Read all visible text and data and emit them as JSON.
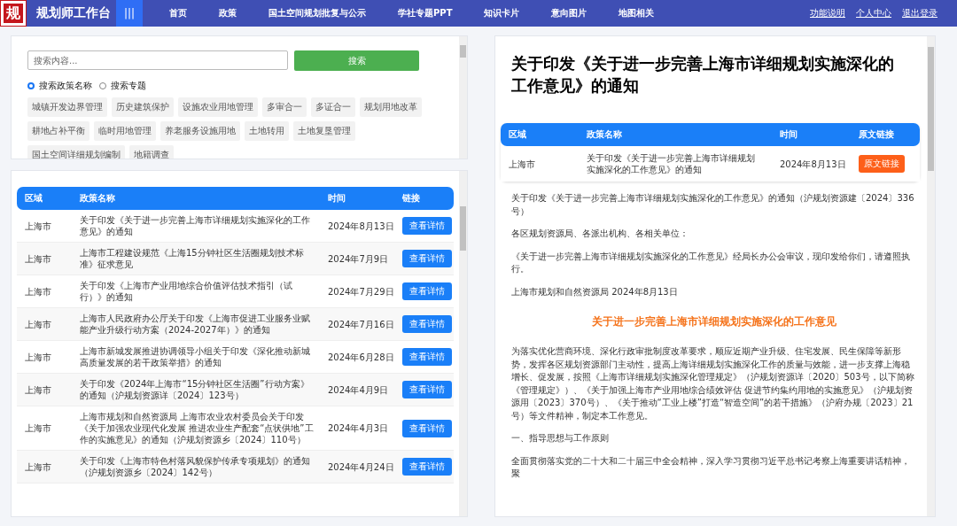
{
  "header": {
    "logo": "规",
    "title": "规划师工作台",
    "menu_button": "|||",
    "nav": [
      {
        "label": "首页"
      },
      {
        "label": "政策"
      },
      {
        "label": "国土空间规划批复与公示"
      },
      {
        "label": "学社专题PPT"
      },
      {
        "label": "知识卡片"
      },
      {
        "label": "意向图片"
      },
      {
        "label": "地图相关"
      }
    ],
    "links": [
      "功能说明",
      "个人中心",
      "退出登录"
    ]
  },
  "search": {
    "placeholder": "搜索内容...",
    "button": "搜索",
    "modes": [
      {
        "label": "搜索政策名称",
        "selected": true
      },
      {
        "label": "搜索专题",
        "selected": false
      }
    ],
    "tags": [
      "城镇开发边界管理",
      "历史建筑保护",
      "设施农业用地管理",
      "多审合一",
      "多证合一",
      "规划用地改革",
      "耕地占补平衡",
      "临时用地管理",
      "养老服务设施用地",
      "土地转用",
      "土地复垦管理",
      "国土空间详细规划编制",
      "地籍调查"
    ]
  },
  "policy_table": {
    "columns": [
      "区域",
      "政策名称",
      "时间",
      "链接"
    ],
    "rows": [
      {
        "region": "上海市",
        "name": "关于印发《关于进一步完善上海市详细规划实施深化的工作意见》的通知",
        "date": "2024年8月13日",
        "action": "查看详情"
      },
      {
        "region": "上海市",
        "name": "上海市工程建设规范《上海15分钟社区生活圈规划技术标准》征求意见",
        "date": "2024年7月9日",
        "action": "查看详情"
      },
      {
        "region": "上海市",
        "name": "关于印发《上海市产业用地综合价值评估技术指引（试行）》的通知",
        "date": "2024年7月29日",
        "action": "查看详情"
      },
      {
        "region": "上海市",
        "name": "上海市人民政府办公厅关于印发《上海市促进工业服务业赋能产业升级行动方案（2024-2027年）》的通知",
        "date": "2024年7月16日",
        "action": "查看详情"
      },
      {
        "region": "上海市",
        "name": "上海市新城发展推进协调领导小组关于印发《深化推动新城高质量发展的若干政策举措》的通知",
        "date": "2024年6月28日",
        "action": "查看详情"
      },
      {
        "region": "上海市",
        "name": "关于印发《2024年上海市“15分钟社区生活圈”行动方案》的通知（沪规划资源详〔2024〕123号）",
        "date": "2024年4月9日",
        "action": "查看详情"
      },
      {
        "region": "上海市",
        "name": "上海市规划和自然资源局 上海市农业农村委员会关于印发《关于加强农业现代化发展 推进农业生产配套“点状供地”工作的实施意见》的通知（沪规划资源乡〔2024〕110号）",
        "date": "2024年4月3日",
        "action": "查看详情"
      },
      {
        "region": "上海市",
        "name": "关于印发《上海市特色村落风貌保护传承专项规划》的通知（沪规划资源乡〔2024〕142号）",
        "date": "2024年4月24日",
        "action": "查看详情"
      }
    ]
  },
  "detail": {
    "title": "关于印发《关于进一步完善上海市详细规划实施深化的工作意见》的通知",
    "table": {
      "columns": [
        "区域",
        "政策名称",
        "时间",
        "原文链接"
      ],
      "row": {
        "region": "上海市",
        "name": "关于印发《关于进一步完善上海市详细规划实施深化的工作意见》的通知",
        "date": "2024年8月13日",
        "action": "原文链接"
      }
    },
    "body": [
      {
        "kind": "para",
        "text": "关于印发《关于进一步完善上海市详细规划实施深化的工作意见》的通知（沪规划资源建〔2024〕336号）"
      },
      {
        "kind": "para",
        "text": "各区规划资源局、各派出机构、各相关单位："
      },
      {
        "kind": "para",
        "text": "《关于进一步完善上海市详细规划实施深化的工作意见》经局长办公会审议，现印发给你们，请遵照执行。"
      },
      {
        "kind": "para",
        "text": "上海市规划和自然资源局 2024年8月13日"
      },
      {
        "kind": "heading",
        "text": "关于进一步完善上海市详细规划实施深化的工作意见"
      },
      {
        "kind": "para",
        "text": "为落实优化营商环境、深化行政审批制度改革要求，顺应近期产业升级、住宅发展、民生保障等新形势，发挥各区规划资源部门主动性，提高上海详细规划实施深化工作的质量与效能，进一步支撑上海稳增长、促发展，按照《上海市详细规划实施深化管理规定》（沪规划资源详〔2020〕503号，以下简称《管理规定》）、《关于加强上海市产业用地综合绩效评估 促进节约集约用地的实施意见》（沪规划资源用〔2023〕370号）、《关于推动“工业上楼”打造“智造空间”的若干措施》（沪府办规〔2023〕21号）等文件精神，制定本工作意见。"
      },
      {
        "kind": "para",
        "text": "一、指导思想与工作原则"
      },
      {
        "kind": "para",
        "text": "全面贯彻落实党的二十大和二十届三中全会精神，深入学习贯彻习近平总书记考察上海重要讲话精神，聚"
      }
    ]
  }
}
